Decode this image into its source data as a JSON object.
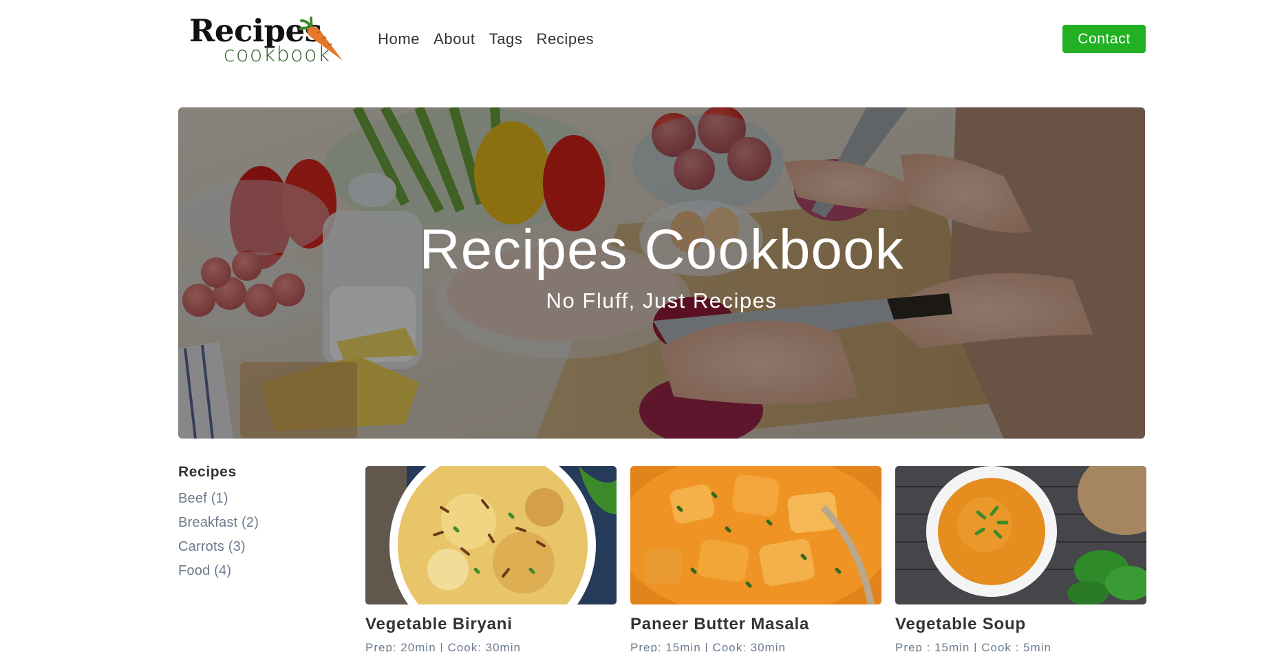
{
  "brand": {
    "logo_word1": "Recipes",
    "logo_word2": "cookbook",
    "accent_color": "#22b123"
  },
  "nav": {
    "items": [
      {
        "label": "Home"
      },
      {
        "label": "About"
      },
      {
        "label": "Tags"
      },
      {
        "label": "Recipes"
      }
    ],
    "contact_label": "Contact"
  },
  "hero": {
    "title": "Recipes Cookbook",
    "subtitle": "No Fluff, Just Recipes"
  },
  "sidebar": {
    "heading": "Recipes",
    "tags": [
      {
        "label": "Beef (1)"
      },
      {
        "label": "Breakfast (2)"
      },
      {
        "label": "Carrots (3)"
      },
      {
        "label": "Food (4)"
      }
    ]
  },
  "recipes": [
    {
      "title": "Vegetable Biryani",
      "meta": "Prep: 20min | Cook: 30min"
    },
    {
      "title": "Paneer Butter Masala",
      "meta": "Prep: 15min | Cook: 30min"
    },
    {
      "title": "Vegetable Soup",
      "meta": "Prep : 15min | Cook : 5min"
    }
  ]
}
